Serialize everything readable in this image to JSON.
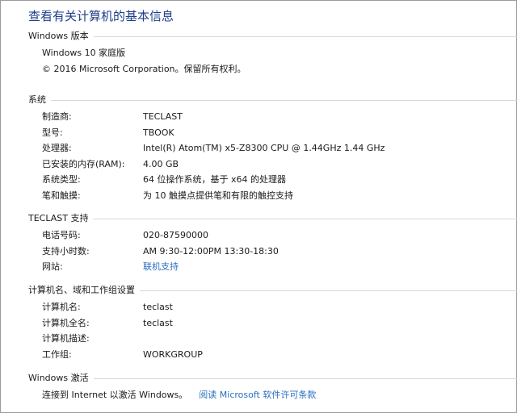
{
  "page_title": "查看有关计算机的基本信息",
  "edition": {
    "title": "Windows 版本",
    "name": "Windows 10 家庭版",
    "copyright": "© 2016 Microsoft Corporation。保留所有权利。"
  },
  "system": {
    "title": "系统",
    "rows": [
      {
        "label": "制造商:",
        "value": "TECLAST"
      },
      {
        "label": "型号:",
        "value": "TBOOK"
      },
      {
        "label": "处理器:",
        "value": "Intel(R) Atom(TM) x5-Z8300  CPU @ 1.44GHz   1.44 GHz"
      },
      {
        "label": "已安装的内存(RAM):",
        "value": "4.00 GB"
      },
      {
        "label": "系统类型:",
        "value": "64 位操作系统，基于 x64 的处理器"
      },
      {
        "label": "笔和触摸:",
        "value": "为 10 触摸点提供笔和有限的触控支持"
      }
    ]
  },
  "support": {
    "title": "TECLAST 支持",
    "rows": [
      {
        "label": "电话号码:",
        "value": "020-87590000"
      },
      {
        "label": "支持小时数:",
        "value": "AM 9:30-12:00PM 13:30-18:30"
      },
      {
        "label": "网站:",
        "value": "联机支持"
      }
    ]
  },
  "computer_name": {
    "title": "计算机名、域和工作组设置",
    "rows": [
      {
        "label": "计算机名:",
        "value": "teclast"
      },
      {
        "label": "计算机全名:",
        "value": "teclast"
      },
      {
        "label": "计算机描述:",
        "value": ""
      },
      {
        "label": "工作组:",
        "value": "WORKGROUP"
      }
    ]
  },
  "activation": {
    "title": "Windows 激活",
    "status": "连接到 Internet 以激活 Windows。",
    "link": "阅读 Microsoft 软件许可条款"
  },
  "colors": {
    "title_blue": "#1e3e8a",
    "link_blue": "#2a6fc2",
    "rule_gray": "#d8d8d8"
  }
}
